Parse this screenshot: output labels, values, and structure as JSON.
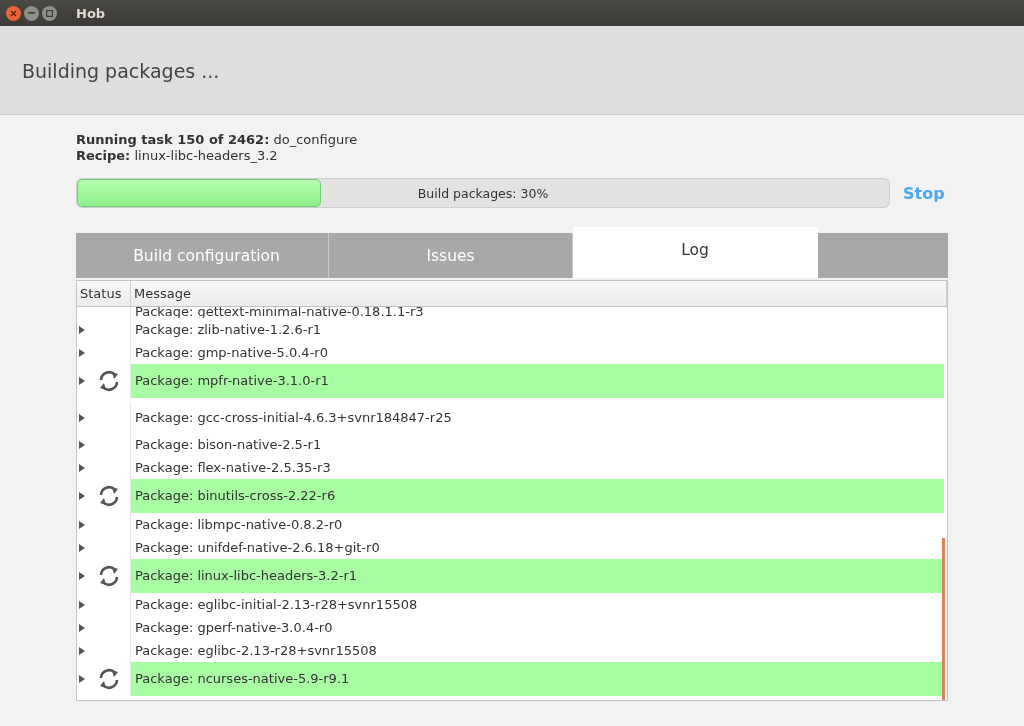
{
  "window": {
    "title": "Hob"
  },
  "header": {
    "title": "Building packages ..."
  },
  "task": {
    "label": "Running task 150 of 2462:",
    "value": "do_configure"
  },
  "recipe": {
    "label": "Recipe:",
    "value": "linux-libc-headers_3.2"
  },
  "progress": {
    "label": "Build packages:  30%",
    "level": 0.3
  },
  "stop_button": "Stop",
  "tabs": [
    {
      "label": "Build configuration",
      "selected": false
    },
    {
      "label": "Issues",
      "selected": false
    },
    {
      "label": "Log",
      "selected": true
    }
  ],
  "table": {
    "columns": [
      "Status",
      "Message"
    ],
    "rows": [
      {
        "message": "Package: gettext-minimal-native-0.18.1.1-r3",
        "running": false,
        "cut": true
      },
      {
        "message": "Package: zlib-native-1.2.6-r1",
        "running": false
      },
      {
        "message": "Package: gmp-native-5.0.4-r0",
        "running": false
      },
      {
        "message": "Package: mpfr-native-3.1.0-r1",
        "running": true
      },
      {
        "message": "Package: gcc-cross-initial-4.6.3+svnr184847-r25",
        "running": false,
        "tall": true
      },
      {
        "message": "Package: bison-native-2.5-r1",
        "running": false
      },
      {
        "message": "Package: flex-native-2.5.35-r3",
        "running": false
      },
      {
        "message": "Package: binutils-cross-2.22-r6",
        "running": true
      },
      {
        "message": "Package: libmpc-native-0.8.2-r0",
        "running": false
      },
      {
        "message": "Package: unifdef-native-2.6.18+git-r0",
        "running": false
      },
      {
        "message": "Package: linux-libc-headers-3.2-r1",
        "running": true
      },
      {
        "message": "Package: eglibc-initial-2.13-r28+svnr15508",
        "running": false
      },
      {
        "message": "Package: gperf-native-3.0.4-r0",
        "running": false
      },
      {
        "message": "Package: eglibc-2.13-r28+svnr15508",
        "running": false
      },
      {
        "message": "Package: ncurses-native-5.9-r9.1",
        "running": true
      }
    ]
  }
}
